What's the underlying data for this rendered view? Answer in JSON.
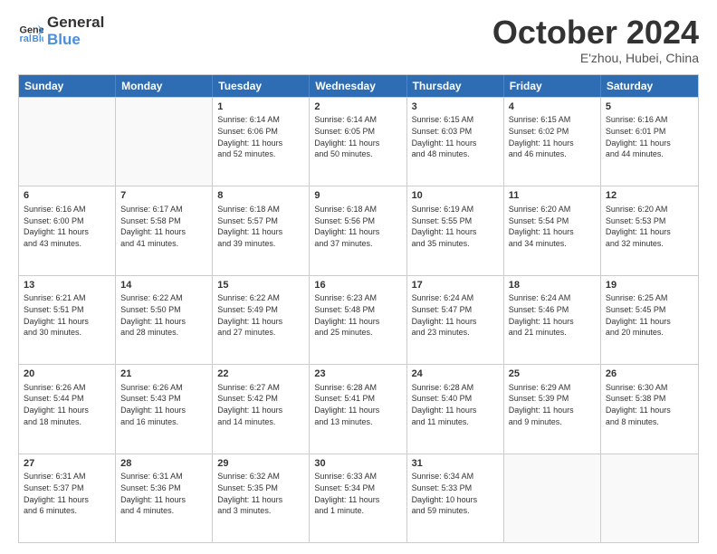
{
  "logo": {
    "text1": "General",
    "text2": "Blue"
  },
  "title": "October 2024",
  "subtitle": "E'zhou, Hubei, China",
  "header_days": [
    "Sunday",
    "Monday",
    "Tuesday",
    "Wednesday",
    "Thursday",
    "Friday",
    "Saturday"
  ],
  "weeks": [
    [
      {
        "day": "",
        "lines": [],
        "empty": true
      },
      {
        "day": "",
        "lines": [],
        "empty": true
      },
      {
        "day": "1",
        "lines": [
          "Sunrise: 6:14 AM",
          "Sunset: 6:06 PM",
          "Daylight: 11 hours",
          "and 52 minutes."
        ]
      },
      {
        "day": "2",
        "lines": [
          "Sunrise: 6:14 AM",
          "Sunset: 6:05 PM",
          "Daylight: 11 hours",
          "and 50 minutes."
        ]
      },
      {
        "day": "3",
        "lines": [
          "Sunrise: 6:15 AM",
          "Sunset: 6:03 PM",
          "Daylight: 11 hours",
          "and 48 minutes."
        ]
      },
      {
        "day": "4",
        "lines": [
          "Sunrise: 6:15 AM",
          "Sunset: 6:02 PM",
          "Daylight: 11 hours",
          "and 46 minutes."
        ]
      },
      {
        "day": "5",
        "lines": [
          "Sunrise: 6:16 AM",
          "Sunset: 6:01 PM",
          "Daylight: 11 hours",
          "and 44 minutes."
        ]
      }
    ],
    [
      {
        "day": "6",
        "lines": [
          "Sunrise: 6:16 AM",
          "Sunset: 6:00 PM",
          "Daylight: 11 hours",
          "and 43 minutes."
        ]
      },
      {
        "day": "7",
        "lines": [
          "Sunrise: 6:17 AM",
          "Sunset: 5:58 PM",
          "Daylight: 11 hours",
          "and 41 minutes."
        ]
      },
      {
        "day": "8",
        "lines": [
          "Sunrise: 6:18 AM",
          "Sunset: 5:57 PM",
          "Daylight: 11 hours",
          "and 39 minutes."
        ]
      },
      {
        "day": "9",
        "lines": [
          "Sunrise: 6:18 AM",
          "Sunset: 5:56 PM",
          "Daylight: 11 hours",
          "and 37 minutes."
        ]
      },
      {
        "day": "10",
        "lines": [
          "Sunrise: 6:19 AM",
          "Sunset: 5:55 PM",
          "Daylight: 11 hours",
          "and 35 minutes."
        ]
      },
      {
        "day": "11",
        "lines": [
          "Sunrise: 6:20 AM",
          "Sunset: 5:54 PM",
          "Daylight: 11 hours",
          "and 34 minutes."
        ]
      },
      {
        "day": "12",
        "lines": [
          "Sunrise: 6:20 AM",
          "Sunset: 5:53 PM",
          "Daylight: 11 hours",
          "and 32 minutes."
        ]
      }
    ],
    [
      {
        "day": "13",
        "lines": [
          "Sunrise: 6:21 AM",
          "Sunset: 5:51 PM",
          "Daylight: 11 hours",
          "and 30 minutes."
        ]
      },
      {
        "day": "14",
        "lines": [
          "Sunrise: 6:22 AM",
          "Sunset: 5:50 PM",
          "Daylight: 11 hours",
          "and 28 minutes."
        ]
      },
      {
        "day": "15",
        "lines": [
          "Sunrise: 6:22 AM",
          "Sunset: 5:49 PM",
          "Daylight: 11 hours",
          "and 27 minutes."
        ]
      },
      {
        "day": "16",
        "lines": [
          "Sunrise: 6:23 AM",
          "Sunset: 5:48 PM",
          "Daylight: 11 hours",
          "and 25 minutes."
        ]
      },
      {
        "day": "17",
        "lines": [
          "Sunrise: 6:24 AM",
          "Sunset: 5:47 PM",
          "Daylight: 11 hours",
          "and 23 minutes."
        ]
      },
      {
        "day": "18",
        "lines": [
          "Sunrise: 6:24 AM",
          "Sunset: 5:46 PM",
          "Daylight: 11 hours",
          "and 21 minutes."
        ]
      },
      {
        "day": "19",
        "lines": [
          "Sunrise: 6:25 AM",
          "Sunset: 5:45 PM",
          "Daylight: 11 hours",
          "and 20 minutes."
        ]
      }
    ],
    [
      {
        "day": "20",
        "lines": [
          "Sunrise: 6:26 AM",
          "Sunset: 5:44 PM",
          "Daylight: 11 hours",
          "and 18 minutes."
        ]
      },
      {
        "day": "21",
        "lines": [
          "Sunrise: 6:26 AM",
          "Sunset: 5:43 PM",
          "Daylight: 11 hours",
          "and 16 minutes."
        ]
      },
      {
        "day": "22",
        "lines": [
          "Sunrise: 6:27 AM",
          "Sunset: 5:42 PM",
          "Daylight: 11 hours",
          "and 14 minutes."
        ]
      },
      {
        "day": "23",
        "lines": [
          "Sunrise: 6:28 AM",
          "Sunset: 5:41 PM",
          "Daylight: 11 hours",
          "and 13 minutes."
        ]
      },
      {
        "day": "24",
        "lines": [
          "Sunrise: 6:28 AM",
          "Sunset: 5:40 PM",
          "Daylight: 11 hours",
          "and 11 minutes."
        ]
      },
      {
        "day": "25",
        "lines": [
          "Sunrise: 6:29 AM",
          "Sunset: 5:39 PM",
          "Daylight: 11 hours",
          "and 9 minutes."
        ]
      },
      {
        "day": "26",
        "lines": [
          "Sunrise: 6:30 AM",
          "Sunset: 5:38 PM",
          "Daylight: 11 hours",
          "and 8 minutes."
        ]
      }
    ],
    [
      {
        "day": "27",
        "lines": [
          "Sunrise: 6:31 AM",
          "Sunset: 5:37 PM",
          "Daylight: 11 hours",
          "and 6 minutes."
        ]
      },
      {
        "day": "28",
        "lines": [
          "Sunrise: 6:31 AM",
          "Sunset: 5:36 PM",
          "Daylight: 11 hours",
          "and 4 minutes."
        ]
      },
      {
        "day": "29",
        "lines": [
          "Sunrise: 6:32 AM",
          "Sunset: 5:35 PM",
          "Daylight: 11 hours",
          "and 3 minutes."
        ]
      },
      {
        "day": "30",
        "lines": [
          "Sunrise: 6:33 AM",
          "Sunset: 5:34 PM",
          "Daylight: 11 hours",
          "and 1 minute."
        ]
      },
      {
        "day": "31",
        "lines": [
          "Sunrise: 6:34 AM",
          "Sunset: 5:33 PM",
          "Daylight: 10 hours",
          "and 59 minutes."
        ]
      },
      {
        "day": "",
        "lines": [],
        "empty": true
      },
      {
        "day": "",
        "lines": [],
        "empty": true
      }
    ]
  ]
}
